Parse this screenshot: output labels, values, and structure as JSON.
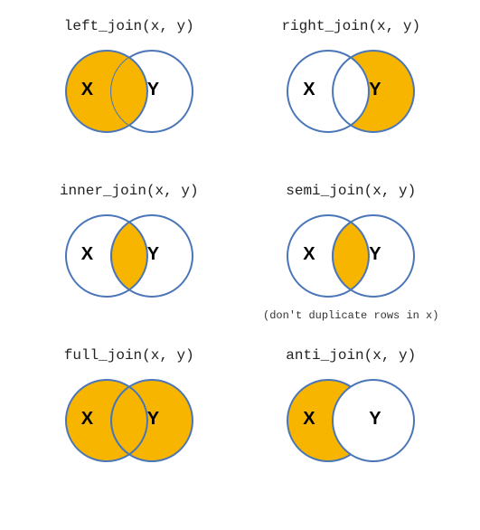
{
  "diagrams": [
    {
      "title": "left_join(x, y)",
      "labelX": "X",
      "labelY": "Y",
      "footnote": ""
    },
    {
      "title": "right_join(x, y)",
      "labelX": "X",
      "labelY": "Y",
      "footnote": ""
    },
    {
      "title": "inner_join(x, y)",
      "labelX": "X",
      "labelY": "Y",
      "footnote": ""
    },
    {
      "title": "semi_join(x, y)",
      "labelX": "X",
      "labelY": "Y",
      "footnote": "(don't duplicate rows in x)"
    },
    {
      "title": "full_join(x, y)",
      "labelX": "X",
      "labelY": "Y",
      "footnote": ""
    },
    {
      "title": "anti_join(x, y)",
      "labelX": "X",
      "labelY": "Y",
      "footnote": ""
    }
  ],
  "colors": {
    "fill": "#f7b500",
    "stroke": "#4a76b8",
    "empty": "#ffffff"
  }
}
